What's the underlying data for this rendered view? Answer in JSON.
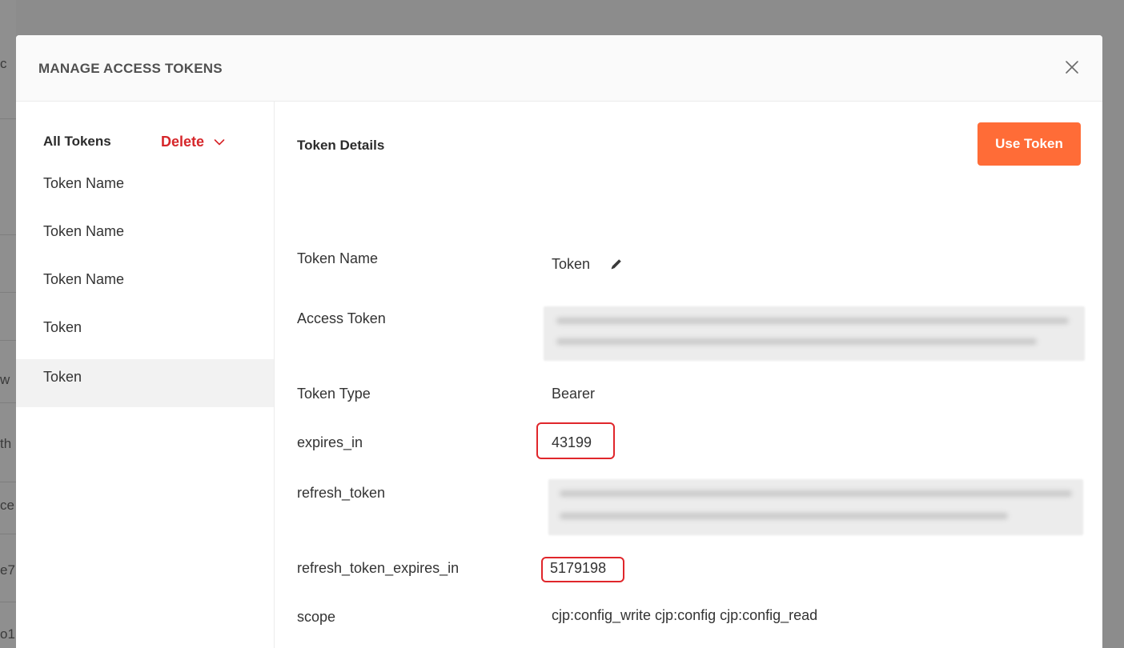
{
  "background": {
    "fragments": [
      "c",
      "w",
      "th",
      "ce",
      "e7",
      "o1"
    ]
  },
  "modal": {
    "title": "MANAGE ACCESS TOKENS",
    "close_icon": "close-icon"
  },
  "sidebar": {
    "header": "All Tokens",
    "delete_label": "Delete",
    "items": [
      {
        "label": "Token Name",
        "active": false
      },
      {
        "label": "Token Name",
        "active": false
      },
      {
        "label": "Token Name",
        "active": false
      },
      {
        "label": "Token",
        "active": false
      },
      {
        "label": "Token",
        "active": true
      }
    ]
  },
  "details": {
    "title": "Token Details",
    "use_token_label": "Use Token",
    "fields": {
      "token_name": {
        "label": "Token Name",
        "value": "Token"
      },
      "access_token": {
        "label": "Access Token"
      },
      "token_type": {
        "label": "Token Type",
        "value": "Bearer"
      },
      "expires_in": {
        "label": "expires_in",
        "value": "43199"
      },
      "refresh_token": {
        "label": "refresh_token"
      },
      "refresh_token_expires_in": {
        "label": "refresh_token_expires_in",
        "value": "5179198"
      },
      "scope": {
        "label": "scope",
        "value": "cjp:config_write cjp:config cjp:config_read"
      }
    }
  },
  "colors": {
    "accent": "#ff6c37",
    "delete": "#d6262a",
    "highlight": "#e0262b",
    "overlay": "#8c8c8c"
  }
}
